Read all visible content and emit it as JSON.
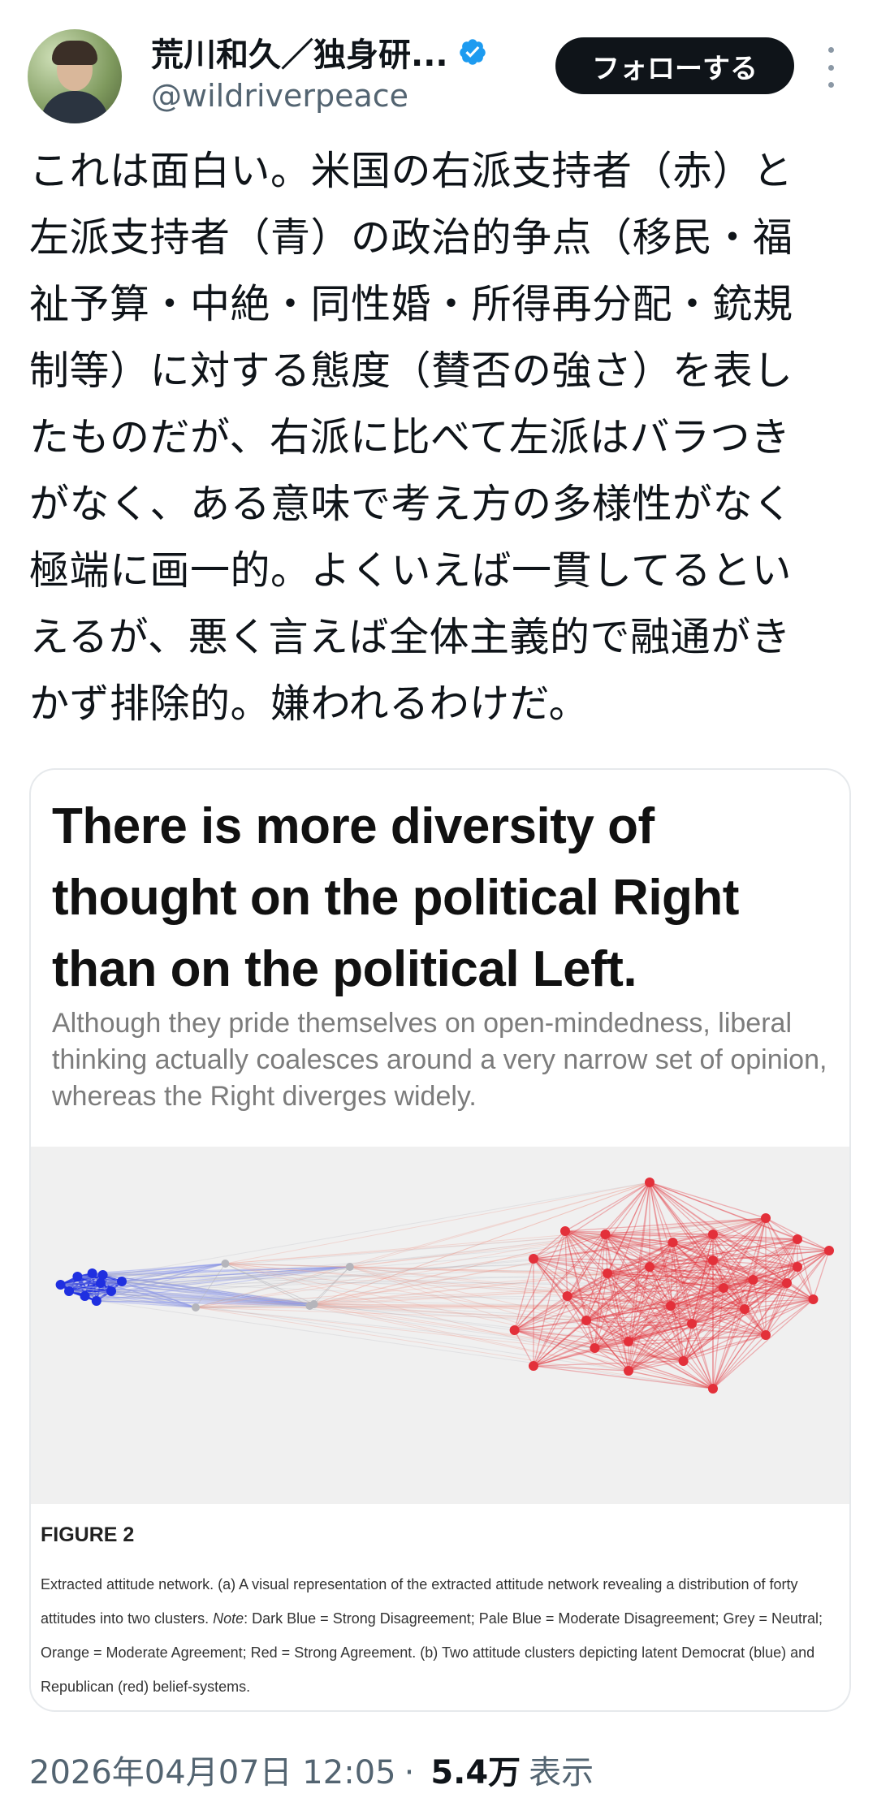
{
  "author": {
    "display_name": "荒川和久／独身研...",
    "handle": "@wildriverpeace",
    "verified": true
  },
  "actions": {
    "follow_label": "フォローする"
  },
  "tweet": {
    "text": "これは面白い。米国の右派支持者（赤）と\n左派支持者（青）の政治的争点（移民・福\n祉予算・中絶・同性婚・所得再分配・銃規\n制等）に対する態度（賛否の強さ）を表し\nたものだが、右派に比べて左派はバラつき\nがなく、ある意味で考え方の多様性がなく\n極端に画一的。よくいえば一貫してるとい\nえるが、悪く言えば全体主義的で融通がき\nかず排除的。嫌われるわけだ。"
  },
  "media": {
    "headline": "There is more diversity of thought on the political Right than on the political Left.",
    "subtitle": "Although they pride themselves on open-mindedness, liberal thinking actually coalesces around a very narrow set of opinion, whereas the Right diverges widely.",
    "figure_label": "FIGURE 2",
    "caption_a": "Extracted attitude network. (a) A visual representation of the extracted attitude network revealing a distribution of forty attitudes into two clusters. ",
    "caption_note": "Note",
    "caption_b": ": Dark Blue = Strong Disagreement; Pale Blue = Moderate Disagreement; Grey = Neutral; Orange = Moderate Agreement; Red = Strong Agreement. (b) Two attitude clusters depicting latent Democrat (blue) and Republican (red) belief-systems.",
    "network_colors": {
      "dark_blue": "#1f2fe0",
      "pale_blue": "#8c96e8",
      "grey": "#b5b5bb",
      "orange": "#ef9a90",
      "red": "#e3303a"
    }
  },
  "meta": {
    "timestamp": "2026年04月07日 12:05",
    "separator": "·",
    "views": "5.4万",
    "views_label": "表示"
  },
  "colors": {
    "follow_bg": "#0f1419",
    "verified": "#1d9bf0",
    "secondary_text": "#536471"
  }
}
